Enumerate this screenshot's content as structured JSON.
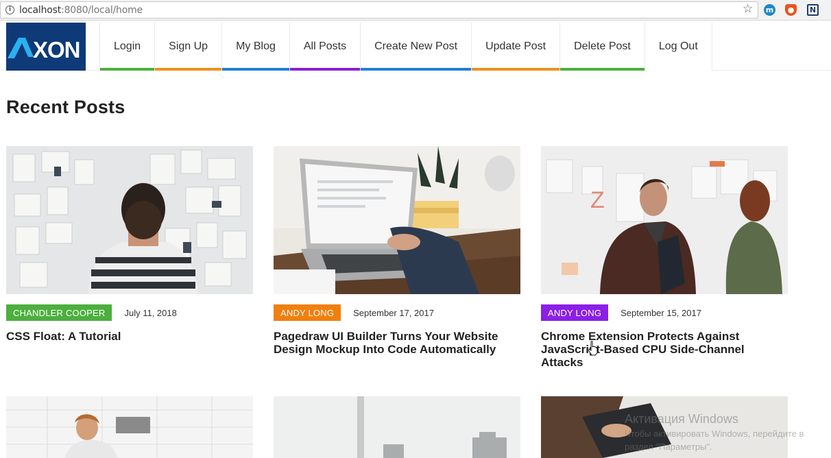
{
  "browser": {
    "url_host": "localhost",
    "url_port_path": ":8080/local/home",
    "info_icon": "i"
  },
  "extensions": {
    "ext1": "m",
    "ext3": "N"
  },
  "logo": {
    "text": "AXON"
  },
  "nav": {
    "items": [
      {
        "label": "Login",
        "color": "#4caf3e"
      },
      {
        "label": "Sign Up",
        "color": "#f0901e"
      },
      {
        "label": "My Blog",
        "color": "#1e7fd6"
      },
      {
        "label": "All Posts",
        "color": "#8b1fd6"
      },
      {
        "label": "Create New Post",
        "color": "#1e7fd6"
      },
      {
        "label": "Update Post",
        "color": "#f0901e"
      },
      {
        "label": "Delete Post",
        "color": "#4caf3e"
      },
      {
        "label": "Log Out",
        "color": "#ffffff"
      }
    ]
  },
  "main": {
    "title": "Recent Posts",
    "posts": [
      {
        "author": "CHANDLER COOPER",
        "author_color": "#4caf3e",
        "date": "July 11, 2018",
        "title": "CSS Float: A Tutorial"
      },
      {
        "author": "ANDY LONG",
        "author_color": "#f07f0e",
        "date": "September 17, 2017",
        "title": "Pagedraw UI Builder Turns Your Website Design Mockup Into Code Automatically"
      },
      {
        "author": "ANDY LONG",
        "author_color": "#8b1fe6",
        "date": "September 15, 2017",
        "title": "Chrome Extension Protects Against JavaScript-Based CPU Side-Channel Attacks"
      }
    ]
  },
  "watermark": {
    "title": "Активация Windows",
    "line1": "Чтобы активировать Windows, перейдите в",
    "line2": "раздел \"Параметры\"."
  }
}
